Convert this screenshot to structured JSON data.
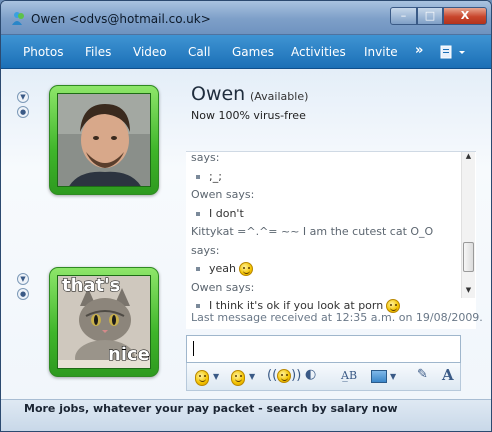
{
  "window": {
    "title": "Owen <odvs@hotmail.co.uk>",
    "controls": {
      "minimize": "–",
      "maximize": "□",
      "close": "X"
    }
  },
  "menu": {
    "items": [
      "Photos",
      "Files",
      "Video",
      "Call",
      "Games",
      "Activities",
      "Invite"
    ],
    "overflow": "»"
  },
  "contact": {
    "name": "Owen",
    "status": "(Available)",
    "personal_message": "Now 100% virus-free"
  },
  "user_avatar": {
    "caption_top": "that's",
    "caption_bottom": "nice"
  },
  "history": [
    {
      "kind": "says",
      "text": "says:"
    },
    {
      "kind": "msg",
      "text": ";_;",
      "emoticon": false
    },
    {
      "kind": "says",
      "text": "Owen says:"
    },
    {
      "kind": "msg",
      "text": "I don't",
      "emoticon": false
    },
    {
      "kind": "says",
      "text": "Kittykat =^.^= ~~ I am the cutest cat O_O"
    },
    {
      "kind": "says",
      "text": "says:"
    },
    {
      "kind": "msg",
      "text": "yeah",
      "emoticon": true
    },
    {
      "kind": "says",
      "text": "Owen says:"
    },
    {
      "kind": "msg",
      "text": "I think it's ok if you look at porn",
      "emoticon": true
    }
  ],
  "last_message": "Last message received at 12:35 a.m. on 19/08/2009.",
  "compose": {
    "value": ""
  },
  "footer": {
    "ad_text": "More jobs, whatever your pay packet - search by salary now"
  },
  "colors": {
    "accent": "#1b6fb6",
    "avatar_frame": "#3fb52a"
  }
}
